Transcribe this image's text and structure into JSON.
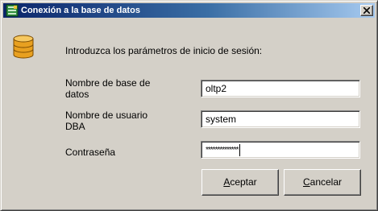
{
  "window": {
    "title": "Conexión a la base de datos",
    "icon": "database-app-icon",
    "close_icon": "close-icon"
  },
  "dialog": {
    "icon": "database-icon",
    "intro": "Introduzca los parámetros de inicio de sesión:"
  },
  "fields": {
    "database": {
      "label": "Nombre de base de datos",
      "value": "oltp2"
    },
    "user": {
      "label": "Nombre de usuario DBA",
      "value": "system"
    },
    "password": {
      "label": "Contraseña",
      "mask": "**************"
    }
  },
  "buttons": {
    "accept": {
      "accel": "A",
      "rest": "ceptar"
    },
    "cancel": {
      "accel": "C",
      "rest": "ancelar"
    }
  },
  "colors": {
    "titlebar_start": "#0a246a",
    "titlebar_end": "#a6caf0",
    "face": "#d4d0c8"
  }
}
